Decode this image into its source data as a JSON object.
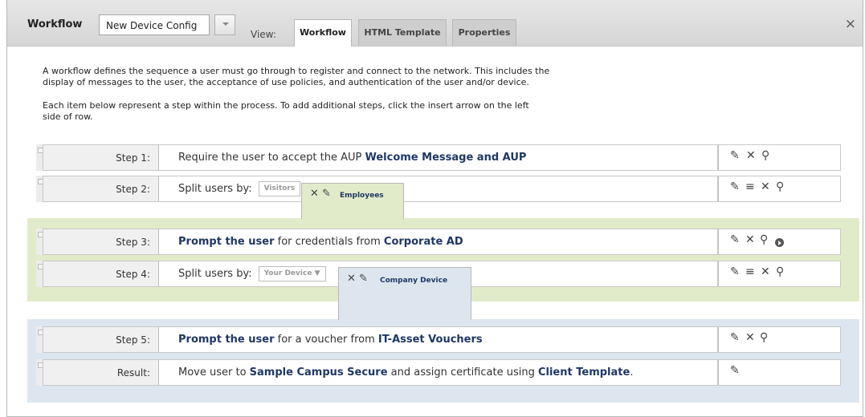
{
  "header": {
    "title": "Workflow",
    "workflow_selected": "New Device Config",
    "view_label": "View:",
    "tabs": [
      "Workflow",
      "HTML Template",
      "Properties"
    ],
    "close": "×"
  },
  "intro": {
    "paragraph1": [
      "A workflow defines the sequence a user must go through to register and connect to the network. This includes the",
      "display of messages to the user, the acceptance of use policies, and authentication of the user and/or device."
    ],
    "paragraph2": [
      "Each item below represent a step within the process. To add additional steps, click the insert arrow on the left",
      "side of row."
    ]
  },
  "icons": {
    "edit": "pencil-icon",
    "delete": "delete-x-icon",
    "view": "magnifier-icon",
    "branch": "list-icon",
    "run": "play-icon"
  },
  "colors": {
    "green_band": "#e1ebc9",
    "blue_band": "#dde6ee",
    "link_text": "#1f3864"
  },
  "steps": [
    {
      "label": "Step 1:",
      "text": [
        "Require the user to accept the AUP ",
        "Welcome Message and AUP"
      ]
    },
    {
      "label": "Step 2:",
      "text": "Split users by:",
      "branch_inactive": "Visitors",
      "branch_active": "Employees"
    },
    {
      "label": "Step 3:",
      "text": [
        "Prompt the user",
        " for credentials from ",
        "Corporate AD"
      ]
    },
    {
      "label": "Step 4:",
      "text": "Split users by:",
      "branch_inactive": "Your Device",
      "branch_active": "Company Device"
    },
    {
      "label": "Step 5:",
      "text": [
        "Prompt the user",
        " for a voucher from ",
        "IT-Asset Vouchers"
      ]
    },
    {
      "label": "Result:",
      "text": [
        "Move user to ",
        "Sample Campus Secure",
        " and assign certificate using ",
        "Client Template",
        "."
      ]
    }
  ]
}
